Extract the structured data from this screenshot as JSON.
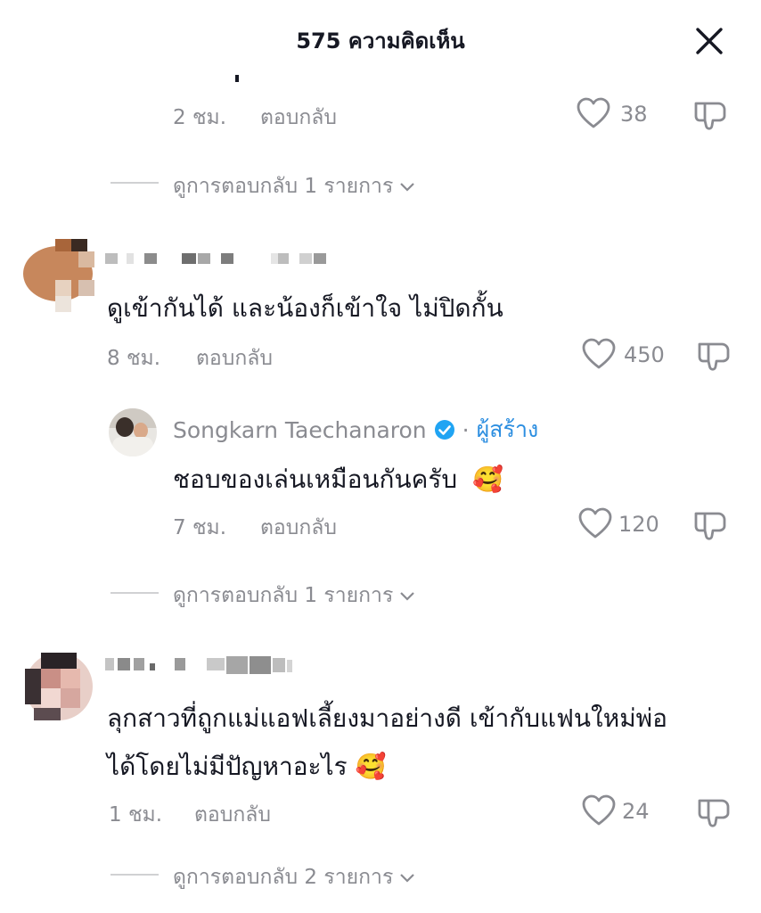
{
  "header": {
    "title": "575 ความคิดเห็น"
  },
  "thread0": {
    "time": "2 ชม.",
    "reply_label": "ตอบกลับ",
    "likes": "38",
    "view_replies": "ดูการตอบกลับ 1 รายการ"
  },
  "comment1": {
    "text": "ดูเข้ากันได้ และน้องก็เข้าใจ ไม่ปิดกั้น",
    "time": "8 ชม.",
    "reply_label": "ตอบกลับ",
    "likes": "450",
    "reply": {
      "author": "Songkarn Taechanaron",
      "separator": "·",
      "creator_label": "ผู้สร้าง",
      "text": "ชอบของเล่นเหมือนกันครับ",
      "emoji": "🥰",
      "time": "7 ชม.",
      "reply_label": "ตอบกลับ",
      "likes": "120"
    },
    "view_replies": "ดูการตอบกลับ 1 รายการ"
  },
  "comment2": {
    "text_line1": "ลุกสาวที่ถูกแม่แอฟเลี้ยงมาอย่างดี เข้ากับแฟนใหม่พ่อ",
    "text_line2": "ได้โดยไม่มีปัญหาอะไร",
    "emoji": "🥰",
    "time": "1 ชม.",
    "reply_label": "ตอบกลับ",
    "likes": "24",
    "view_replies": "ดูการตอบกลับ 2 รายการ"
  },
  "colors": {
    "text": "#161823",
    "muted": "#8a8b91",
    "verified": "#20a4f3",
    "creator": "#2c8ee0"
  },
  "icons": [
    "close-icon",
    "heart-icon",
    "dislike-icon",
    "chevron-down-icon",
    "verified-icon"
  ]
}
